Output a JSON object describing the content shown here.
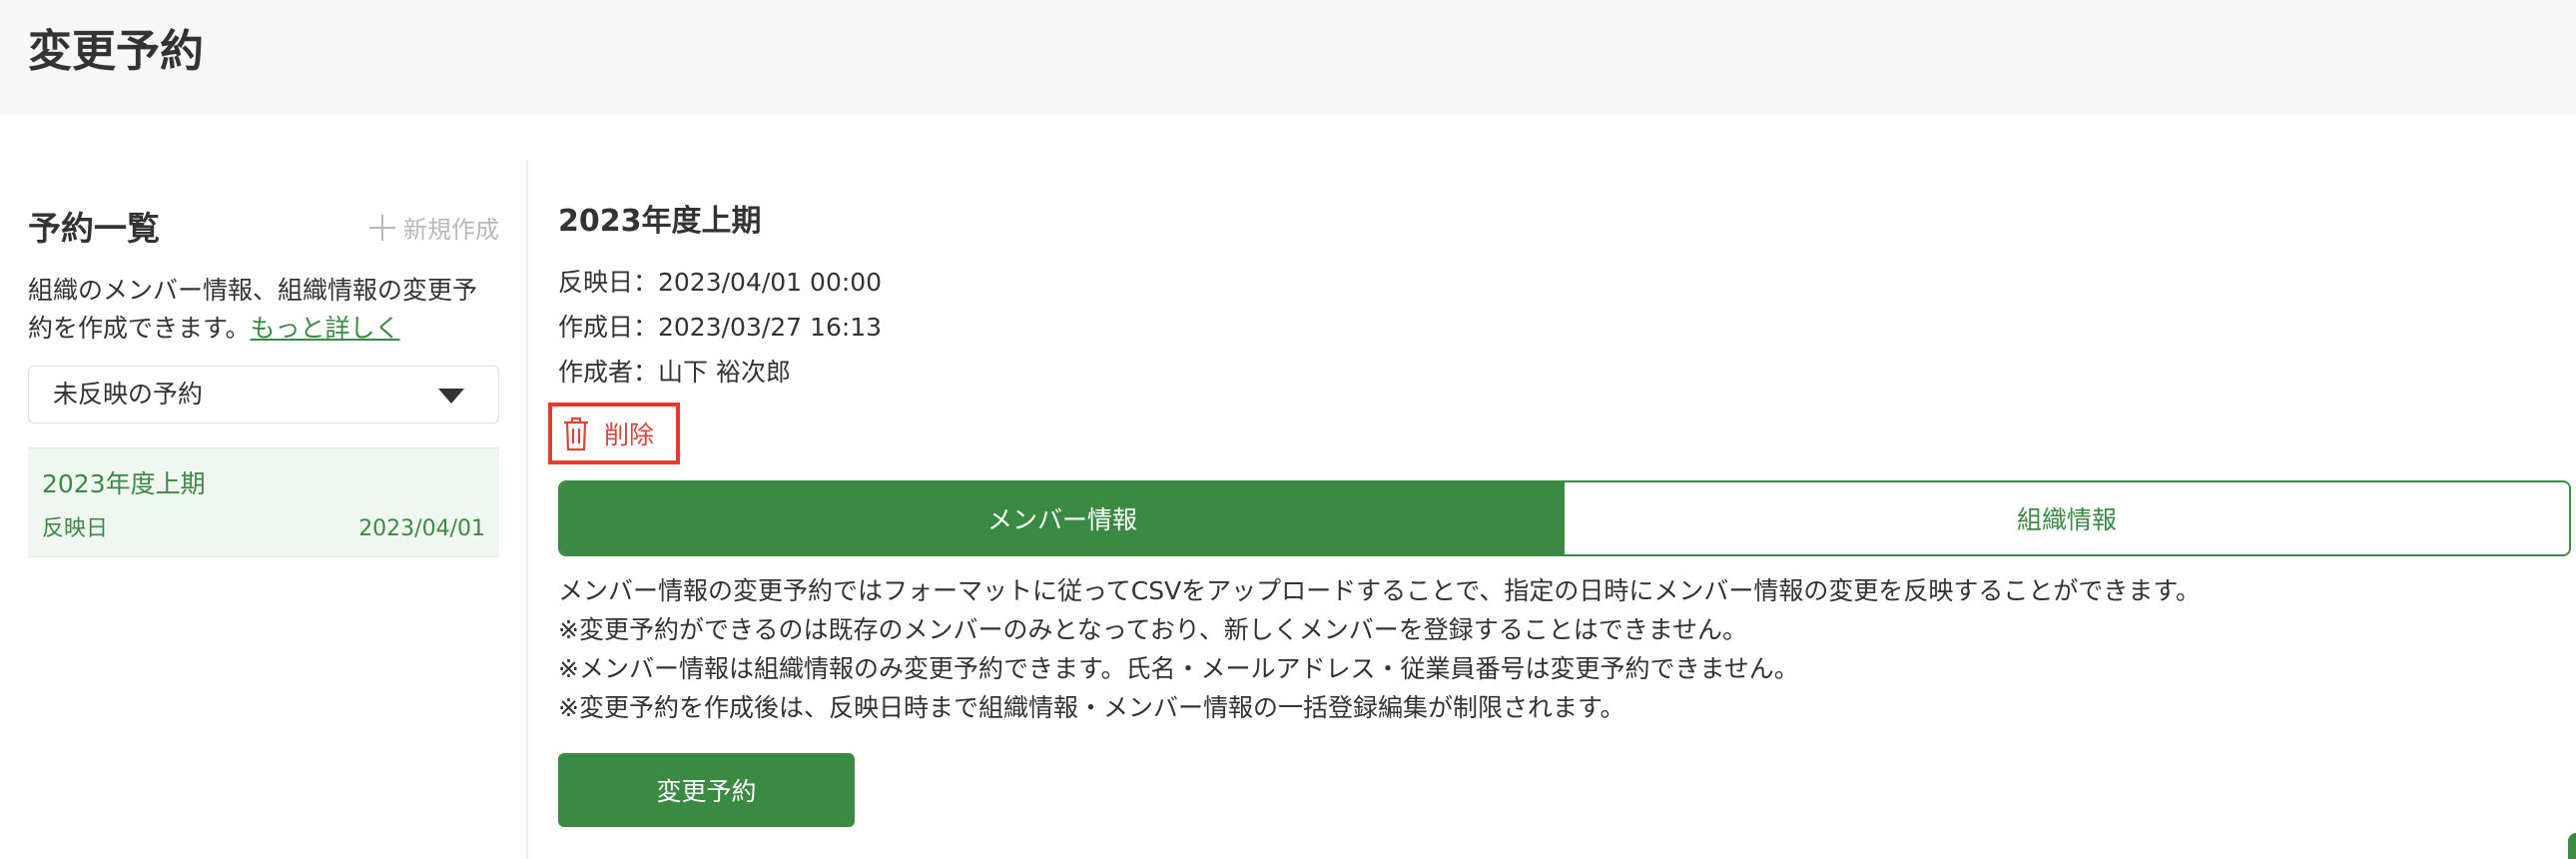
{
  "page": {
    "title": "変更予約"
  },
  "sidebar": {
    "title": "予約一覧",
    "new_button_label": "新規作成",
    "description": "組織のメンバー情報、組織情報の変更予約を作成できます。",
    "more_link": "もっと詳しく",
    "filter": {
      "selected": "未反映の予約"
    },
    "items": [
      {
        "title": "2023年度上期",
        "label": "反映日",
        "date": "2023/04/01"
      }
    ]
  },
  "detail": {
    "title": "2023年度上期",
    "reflect_date": "反映日：2023/04/01 00:00",
    "created_date": "作成日：2023/03/27 16:13",
    "author": "作成者：山下 裕次郎",
    "delete_label": "削除"
  },
  "tabs": [
    {
      "label": "メンバー情報",
      "active": true
    },
    {
      "label": "組織情報",
      "active": false
    }
  ],
  "notes": [
    "メンバー情報の変更予約ではフォーマットに従ってCSVをアップロードすることで、指定の日時にメンバー情報の変更を反映することができます。",
    "※変更予約ができるのは既存のメンバーのみとなっており、新しくメンバーを登録することはできません。",
    "※メンバー情報は組織情報のみ変更予約できます。氏名・メールアドレス・従業員番号は変更予約できません。",
    "※変更予約を作成後は、反映日時まで組織情報・メンバー情報の一括登録編集が制限されます。"
  ],
  "primary_button_label": "変更予約",
  "colors": {
    "accent": "#3b8a44",
    "danger": "#e23d2a",
    "header_bg": "#f6f7f6",
    "selected_item_bg": "#f0f6f0"
  },
  "icons": [
    "plus-icon",
    "chevron-down-icon",
    "trash-icon"
  ]
}
